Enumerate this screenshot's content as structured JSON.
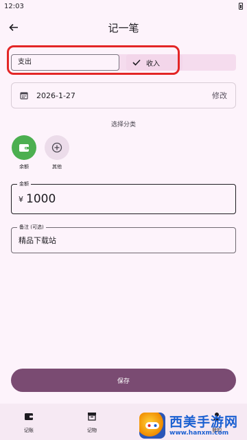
{
  "status_bar": {
    "time": "12:03"
  },
  "app_bar": {
    "title": "记一笔"
  },
  "type_toggle": {
    "expense_label": "支出",
    "income_label": "收入",
    "selected": "income"
  },
  "date_row": {
    "date": "2026-1-27",
    "edit_label": "修改"
  },
  "category_section": {
    "title": "选择分类",
    "items": [
      {
        "label": "余额",
        "icon": "wallet-icon",
        "selected": true,
        "color": "#4caf50"
      },
      {
        "label": "其他",
        "icon": "plus-circle-icon",
        "selected": false,
        "color": "#ecdcea"
      }
    ]
  },
  "amount_field": {
    "label": "金额",
    "currency": "¥",
    "value": "1000"
  },
  "note_field": {
    "label": "备注 (可选)",
    "value": "精品下载站"
  },
  "save_button": {
    "label": "保存"
  },
  "bottom_nav": {
    "items": [
      {
        "label": "记账",
        "icon": "wallet-icon"
      },
      {
        "label": "记物",
        "icon": "archive-box-icon"
      },
      {
        "label": "我的",
        "icon": "person-icon"
      }
    ]
  },
  "watermark": {
    "title": "西美手游网",
    "url": "www.hanxm.com"
  },
  "colors": {
    "accent": "#7a4b72",
    "background": "#fdf3fb",
    "highlight": "#e32626"
  }
}
